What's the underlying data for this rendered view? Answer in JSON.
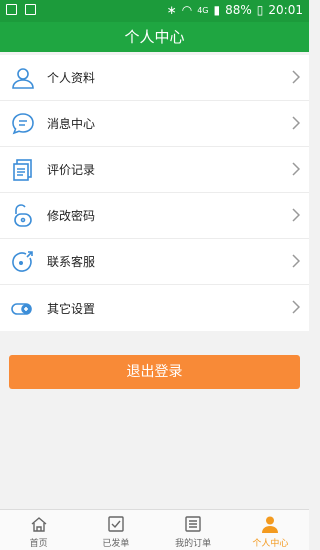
{
  "status_bar": {
    "battery": "88%",
    "time": "20:01",
    "network": "4G"
  },
  "header": {
    "title": "个人中心"
  },
  "menu": {
    "items": [
      {
        "label": "个人资料",
        "icon": "person-icon"
      },
      {
        "label": "消息中心",
        "icon": "message-icon"
      },
      {
        "label": "评价记录",
        "icon": "document-icon"
      },
      {
        "label": "修改密码",
        "icon": "lock-icon"
      },
      {
        "label": "联系客服",
        "icon": "customer-service-icon"
      },
      {
        "label": "其它设置",
        "icon": "settings-icon"
      }
    ]
  },
  "logout_label": "退出登录",
  "tabs": [
    {
      "label": "首页",
      "icon": "home-icon"
    },
    {
      "label": "已发单",
      "icon": "checkbox-icon"
    },
    {
      "label": "我的订单",
      "icon": "order-icon"
    },
    {
      "label": "个人中心",
      "icon": "profile-icon"
    }
  ],
  "colors": {
    "status_bar": "#1c9b3b",
    "header": "#1fa641",
    "accent": "#f88a37",
    "icon_blue": "#3d8ed8",
    "active_tab": "#f39a1f"
  }
}
